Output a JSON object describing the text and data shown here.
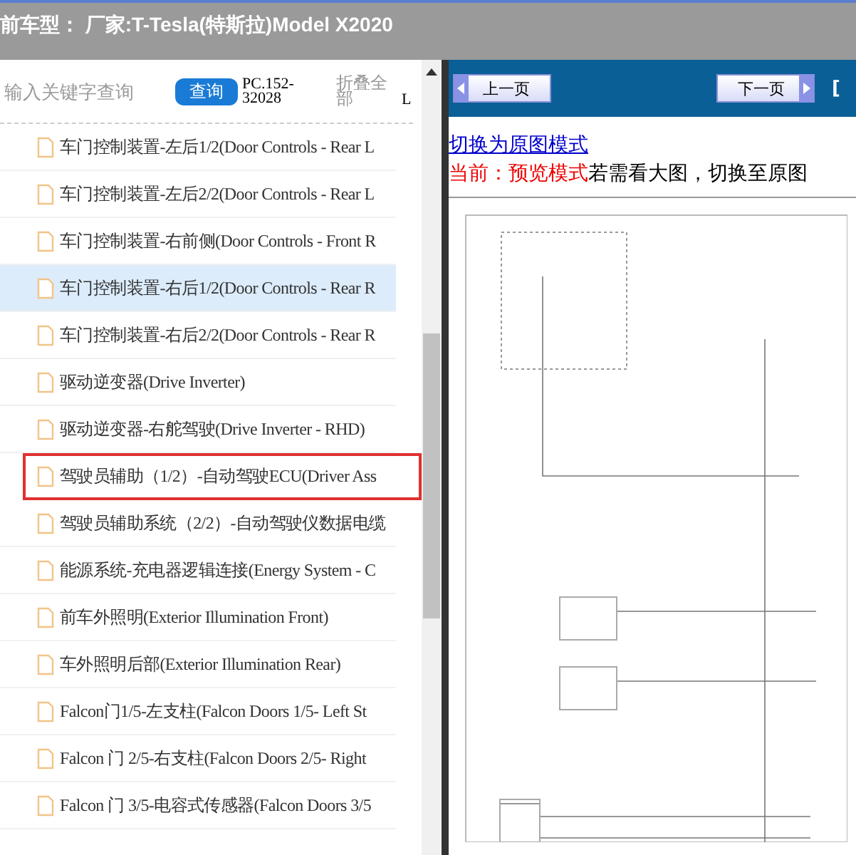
{
  "title_bar": {
    "text": "前车型：  厂家:T-Tesla(特斯拉)Model X2020"
  },
  "toolbar": {
    "search": {
      "placeholder": "输入关键字查询"
    },
    "search_button": "查询",
    "code": "PC.152-32028",
    "collapse_all": "折叠全部",
    "column_5": "L"
  },
  "tree": {
    "items": [
      {
        "label": "车门控制装置-左后1/2(Door Controls - Rear L",
        "selected": false,
        "hovered": false
      },
      {
        "label": "车门控制装置-左后2/2(Door Controls - Rear L",
        "selected": false,
        "hovered": false
      },
      {
        "label": "车门控制装置-右前侧(Door Controls - Front R",
        "selected": false,
        "hovered": false
      },
      {
        "label": "车门控制装置-右后1/2(Door Controls - Rear R",
        "selected": false,
        "hovered": true
      },
      {
        "label": "车门控制装置-右后2/2(Door Controls - Rear R",
        "selected": false,
        "hovered": false
      },
      {
        "label": "驱动逆变器(Drive Inverter)",
        "selected": false,
        "hovered": false
      },
      {
        "label": "驱动逆变器-右舵驾驶(Drive Inverter - RHD)",
        "selected": false,
        "hovered": false
      },
      {
        "label": "驾驶员辅助（1/2）-自动驾驶ECU(Driver Ass",
        "selected": true,
        "hovered": false
      },
      {
        "label": "驾驶员辅助系统（2/2）-自动驾驶仪数据电缆",
        "selected": false,
        "hovered": false
      },
      {
        "label": "能源系统-充电器逻辑连接(Energy System - C",
        "selected": false,
        "hovered": false
      },
      {
        "label": "前车外照明(Exterior Illumination Front)",
        "selected": false,
        "hovered": false
      },
      {
        "label": "车外照明后部(Exterior Illumination Rear)",
        "selected": false,
        "hovered": false
      },
      {
        "label": "Falcon门1/5-左支柱(Falcon Doors 1/5- Left St",
        "selected": false,
        "hovered": false
      },
      {
        "label": "Falcon 门 2/5-右支柱(Falcon Doors 2/5- Right",
        "selected": false,
        "hovered": false
      },
      {
        "label": "Falcon 门 3/5-电容式传感器(Falcon Doors 3/5",
        "selected": false,
        "hovered": false
      }
    ]
  },
  "viewer": {
    "prev_button": "上一页",
    "next_button": "下一页",
    "column_3": "[",
    "mode_link": "切换为原图模式",
    "mode_status": "当前：预览模式",
    "mode_hint": "若需看大图，切换至原图"
  }
}
